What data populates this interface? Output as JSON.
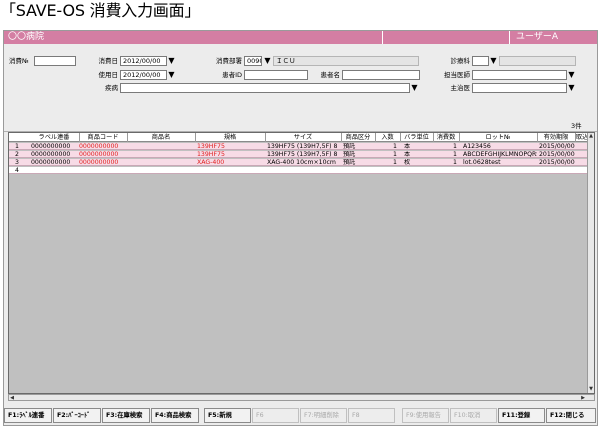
{
  "page_title": "「SAVE-OS 消費入力画面」",
  "app": {
    "name": "〇〇病院",
    "user": "ユーザーA"
  },
  "form": {
    "consume_no_label": "消費№",
    "consume_date_label": "消費日",
    "consume_date": "2012/00/00",
    "use_date_label": "使用日",
    "use_date": "2012/00/00",
    "dept_label": "消費部署",
    "dept_code": "0090",
    "dept_name": "ＩＣＵ",
    "patient_id_label": "患者ID",
    "patient_name_label": "患者名",
    "disease_label": "疾病",
    "clinic_label": "診療科",
    "doctor_label": "担当医師",
    "main_label": "主治医"
  },
  "result_count": "3件",
  "table": {
    "headers": [
      "ラベル連番",
      "商品コード",
      "商品名",
      "規格",
      "サイズ",
      "商品区分",
      "入数",
      "バラ単位",
      "消費数",
      "ロット№",
      "有効期限",
      "取込"
    ],
    "rows": [
      {
        "no": "1",
        "label": "0000000000",
        "code": "0000000000",
        "name": "",
        "spec": "139HF75",
        "size": "139HF75 (139H7,5F) 8",
        "category": "預託",
        "qty": "1",
        "unit": "本",
        "consume": "1",
        "lot": "A123456",
        "expiry": "2015/00/00"
      },
      {
        "no": "2",
        "label": "0000000000",
        "code": "0000000000",
        "name": "",
        "spec": "139HF75",
        "size": "139HF75 (139H7,5F) 8",
        "category": "預託",
        "qty": "1",
        "unit": "本",
        "consume": "1",
        "lot": "ABCDEFGHIJKLMNOPQRST",
        "expiry": "2015/00/00"
      },
      {
        "no": "3",
        "label": "0000000000",
        "code": "0000000000",
        "name": "",
        "spec": "XAG-400",
        "size": "XAG-400 10cm×10cm",
        "category": "預託",
        "qty": "1",
        "unit": "枚",
        "consume": "1",
        "lot": "lot.0628test",
        "expiry": "2015/00/00"
      },
      {
        "no": "4",
        "label": "",
        "code": "",
        "name": "",
        "spec": "",
        "size": "",
        "category": "",
        "qty": "",
        "unit": "",
        "consume": "",
        "lot": "",
        "expiry": ""
      }
    ]
  },
  "function_keys": [
    {
      "label": "F1:ﾗﾍﾞﾙ連番",
      "enabled": true
    },
    {
      "label": "F2:ﾊﾞｰｺｰﾄﾞ",
      "enabled": true
    },
    {
      "label": "F3:在庫検索",
      "enabled": true
    },
    {
      "label": "F4:商品検索",
      "enabled": true
    },
    {
      "label": "F5:新規",
      "enabled": true
    },
    {
      "label": "F6",
      "enabled": false
    },
    {
      "label": "F7:明細削除",
      "enabled": false
    },
    {
      "label": "F8",
      "enabled": false
    },
    {
      "label": "F9:使用報告",
      "enabled": false
    },
    {
      "label": "F10:取消",
      "enabled": false
    },
    {
      "label": "F11:登録",
      "enabled": true
    },
    {
      "label": "F12:閉じる",
      "enabled": true
    }
  ],
  "colors": {
    "title_bar": "#d47ea3",
    "row_bg": "#f7dbe6",
    "code_red": "#e02020"
  },
  "icons": {
    "dropdown": "triangle-down",
    "scroll_up": "triangle-up",
    "scroll_down": "triangle-down",
    "scroll_left": "triangle-left",
    "scroll_right": "triangle-right"
  }
}
